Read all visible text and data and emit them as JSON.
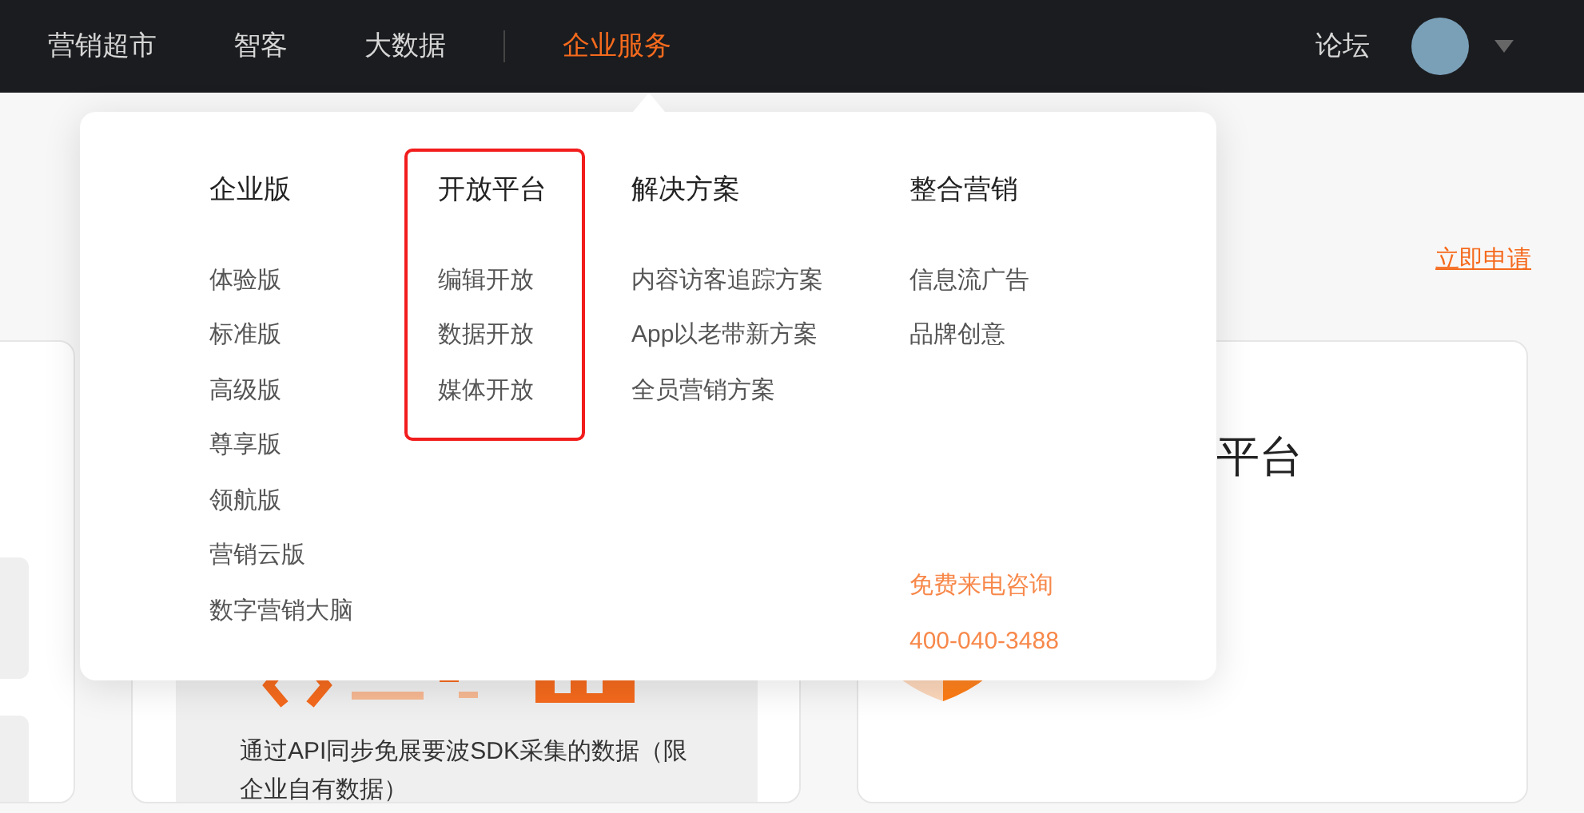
{
  "navbar": {
    "items": [
      {
        "label": "营销超市",
        "selected": false
      },
      {
        "label": "智客",
        "selected": false
      },
      {
        "label": "大数据",
        "selected": false
      },
      {
        "label": "企业服务",
        "selected": true
      }
    ],
    "right_items": [
      {
        "label": "论坛"
      }
    ]
  },
  "dropdown": {
    "columns": [
      {
        "heading": "企业版",
        "highlighted": false,
        "items": [
          "体验版",
          "标准版",
          "高级版",
          "尊享版",
          "领航版",
          "营销云版",
          "数字营销大脑"
        ]
      },
      {
        "heading": "开放平台",
        "highlighted": true,
        "items": [
          "编辑开放",
          "数据开放",
          "媒体开放"
        ]
      },
      {
        "heading": "解决方案",
        "highlighted": false,
        "items": [
          "内容访客追踪方案",
          "App以老带新方案",
          "全员营销方案"
        ]
      },
      {
        "heading": "整合营销",
        "highlighted": false,
        "items": [
          "信息流广告",
          "品牌创意"
        ],
        "contact": [
          "免费来电咨询",
          "400-040-3488"
        ]
      }
    ]
  },
  "page": {
    "apply_link": "立即申请",
    "middle_card": {
      "description": "通过API同步免展要波SDK采集的数据（限企业自有数据）"
    },
    "right_card": {
      "title": "平台"
    }
  }
}
